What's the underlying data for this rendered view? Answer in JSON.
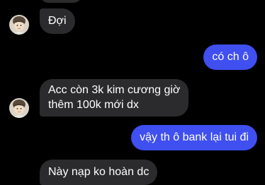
{
  "conversation": {
    "messages": [
      {
        "from": "contact",
        "text": ""
      },
      {
        "from": "contact",
        "text": "Đợi"
      },
      {
        "from": "me",
        "text": "có ch ô"
      },
      {
        "from": "contact",
        "lines": [
          "Acc còn 3k kim cương giờ",
          "thêm 100k mới dx"
        ]
      },
      {
        "from": "me",
        "text": "vậy th ô bank lại tui đi"
      },
      {
        "from": "contact",
        "text": "Này nạp ko hoàn dc"
      }
    ]
  },
  "colors": {
    "background": "#000000",
    "incoming_bubble": "#2b2b2d",
    "outgoing_bubble": "#3f4ff0",
    "text": "#ffffff"
  },
  "icons": {
    "avatar": "contact-avatar-photo"
  }
}
